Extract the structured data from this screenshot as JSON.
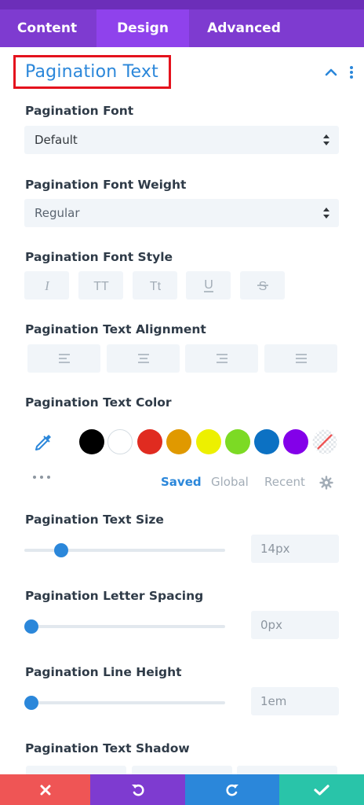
{
  "tabs": [
    {
      "label": "Content",
      "active": false
    },
    {
      "label": "Design",
      "active": true
    },
    {
      "label": "Advanced",
      "active": false
    }
  ],
  "section": {
    "title": "Pagination Text",
    "collapse_icon": "chevron-up-icon",
    "more_icon": "vertical-dots-icon"
  },
  "font": {
    "label": "Pagination Font",
    "value": "Default"
  },
  "font_weight": {
    "label": "Pagination Font Weight",
    "value": "Regular"
  },
  "font_style": {
    "label": "Pagination Font Style",
    "buttons": [
      "I",
      "TT",
      "Tt",
      "U",
      "S"
    ],
    "icons": [
      "italic-icon",
      "uppercase-icon",
      "capitalize-icon",
      "underline-icon",
      "strikethrough-icon"
    ]
  },
  "text_alignment": {
    "label": "Pagination Text Alignment",
    "icons": [
      "align-left-icon",
      "align-center-icon",
      "align-right-icon",
      "align-justify-icon"
    ]
  },
  "text_color": {
    "label": "Pagination Text Color",
    "swatches": [
      "#000000",
      "#ffffff",
      "#e02b20",
      "#e09900",
      "#edf000",
      "#7cda24",
      "#0c71c3",
      "#8300e9"
    ],
    "tabs": {
      "saved": "Saved",
      "global": "Global",
      "recent": "Recent"
    },
    "active_tab": "Saved"
  },
  "text_size": {
    "label": "Pagination Text Size",
    "value": "14px",
    "slider_fraction": 0.16
  },
  "letter_spacing": {
    "label": "Pagination Letter Spacing",
    "value": "0px",
    "slider_fraction": 0.0
  },
  "line_height": {
    "label": "Pagination Line Height",
    "value": "1em",
    "slider_fraction": 0.0
  },
  "text_shadow": {
    "label": "Pagination Text Shadow"
  },
  "colors": {
    "accent": "#2b87da",
    "tab_bar": "#7e3bd0",
    "discard": "#ef5555",
    "undo": "#7e3bd0",
    "redo": "#2b87da",
    "save": "#29c4a9"
  }
}
